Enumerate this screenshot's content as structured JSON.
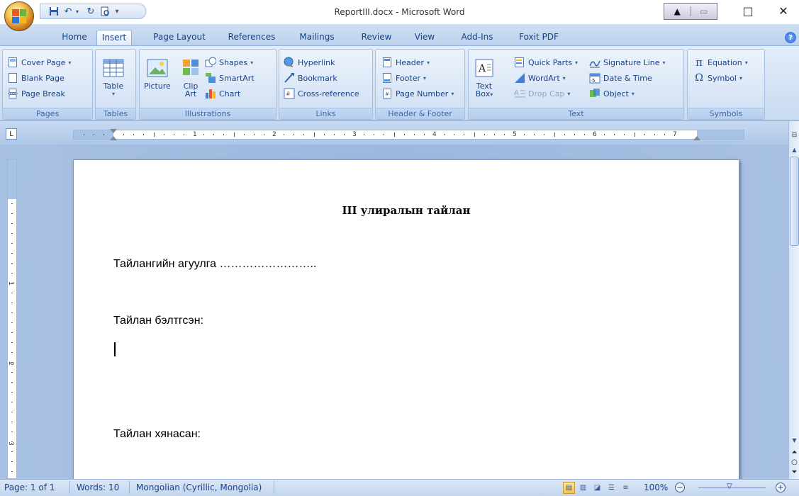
{
  "window": {
    "title": "ReportIII.docx - Microsoft Word"
  },
  "tabs": [
    {
      "label": "Home"
    },
    {
      "label": "Insert",
      "active": true
    },
    {
      "label": "Page Layout"
    },
    {
      "label": "References"
    },
    {
      "label": "Mailings"
    },
    {
      "label": "Review"
    },
    {
      "label": "View"
    },
    {
      "label": "Add-Ins"
    },
    {
      "label": "Foxit PDF"
    }
  ],
  "ribbon": {
    "pages": {
      "label": "Pages",
      "cover_page": "Cover Page",
      "blank_page": "Blank Page",
      "page_break": "Page Break"
    },
    "tables": {
      "label": "Tables",
      "table": "Table"
    },
    "illustrations": {
      "label": "Illustrations",
      "picture": "Picture",
      "clip_art_line1": "Clip",
      "clip_art_line2": "Art",
      "shapes": "Shapes",
      "smartart": "SmartArt",
      "chart": "Chart"
    },
    "links": {
      "label": "Links",
      "hyperlink": "Hyperlink",
      "bookmark": "Bookmark",
      "cross_reference": "Cross-reference"
    },
    "header_footer": {
      "label": "Header & Footer",
      "header": "Header",
      "footer": "Footer",
      "page_number": "Page Number"
    },
    "text": {
      "label": "Text",
      "text_box_line1": "Text",
      "text_box_line2": "Box",
      "quick_parts": "Quick Parts",
      "wordart": "WordArt",
      "drop_cap": "Drop Cap",
      "signature_line": "Signature Line",
      "date_time": "Date & Time",
      "object": "Object"
    },
    "symbols": {
      "label": "Symbols",
      "equation": "Equation",
      "symbol": "Symbol"
    }
  },
  "ruler": {
    "numbers": [
      "1",
      "2",
      "3",
      "4",
      "5",
      "6",
      "7"
    ],
    "vertical_numbers": [
      "1",
      "2",
      "3"
    ]
  },
  "document": {
    "title": "III улиралын тайлан",
    "line1": "Тайлангийн агуулга ……………………..",
    "line2": "Тайлан бэлтгсэн:",
    "line3": "Тайлан хянасан:"
  },
  "status": {
    "page": "Page: 1 of 1",
    "words": "Words: 10",
    "language": "Mongolian (Cyrillic, Mongolia)",
    "zoom": "100%"
  },
  "colors": {
    "accent": "#15428b",
    "ribbon_bg": "#d3e2f5",
    "workspace_bg": "#a9c0e0"
  }
}
